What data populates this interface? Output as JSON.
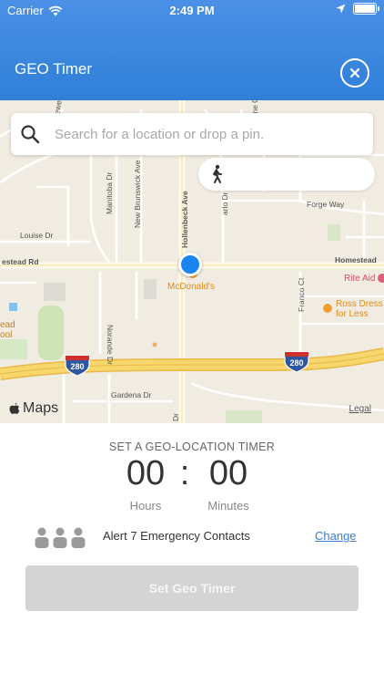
{
  "status_bar": {
    "carrier": "Carrier",
    "time": "2:49 PM",
    "battery_level": 0.9
  },
  "header": {
    "title": "GEO Timer",
    "close_icon": "close-circle-icon"
  },
  "search": {
    "placeholder": "Search for a location or drop a pin.",
    "icon": "search-icon"
  },
  "transport_mode": {
    "icon": "walking-person-icon"
  },
  "map": {
    "streets": {
      "newell": "Newell",
      "manitoba": "Manitoba Dr",
      "new_brunswick": "New Brunswick Ave",
      "hollenbeck": "Hollenbeck Ave",
      "louise": "Louise Dr",
      "forge": "Forge Way",
      "homestead_left": "estead Rd",
      "homestead_right": "Homestead",
      "norande": "Norande Dr",
      "franco": "Franco Ct",
      "gardena": "Gardena Dr",
      "dr_fragment": "Dr",
      "arlo": "arlo Dr",
      "dlene": "dlene Ct"
    },
    "pois": {
      "mcdonalds": "McDonald's",
      "rite_aid": "Rite Aid",
      "ross_line1": "Ross Dress",
      "ross_line2": "for Less",
      "school_line1": "ead",
      "school_line2": "ool"
    },
    "highway_shield": "280",
    "attribution": "Maps",
    "legal": "Legal"
  },
  "timer": {
    "label": "SET A GEO-LOCATION TIMER",
    "hours": "00",
    "colon": ":",
    "minutes": "00",
    "hours_label": "Hours",
    "minutes_label": "Minutes"
  },
  "contacts": {
    "icon": "contacts-group-icon",
    "text": "Alert 7 Emergency Contacts",
    "change_label": "Change"
  },
  "action": {
    "set_label": "Set Geo Timer"
  },
  "colors": {
    "header": "#3a88e0",
    "pin": "#1a84f0",
    "link": "#3b7bd6",
    "button_disabled": "#d4d4d4",
    "highway": "#f2c94c"
  }
}
